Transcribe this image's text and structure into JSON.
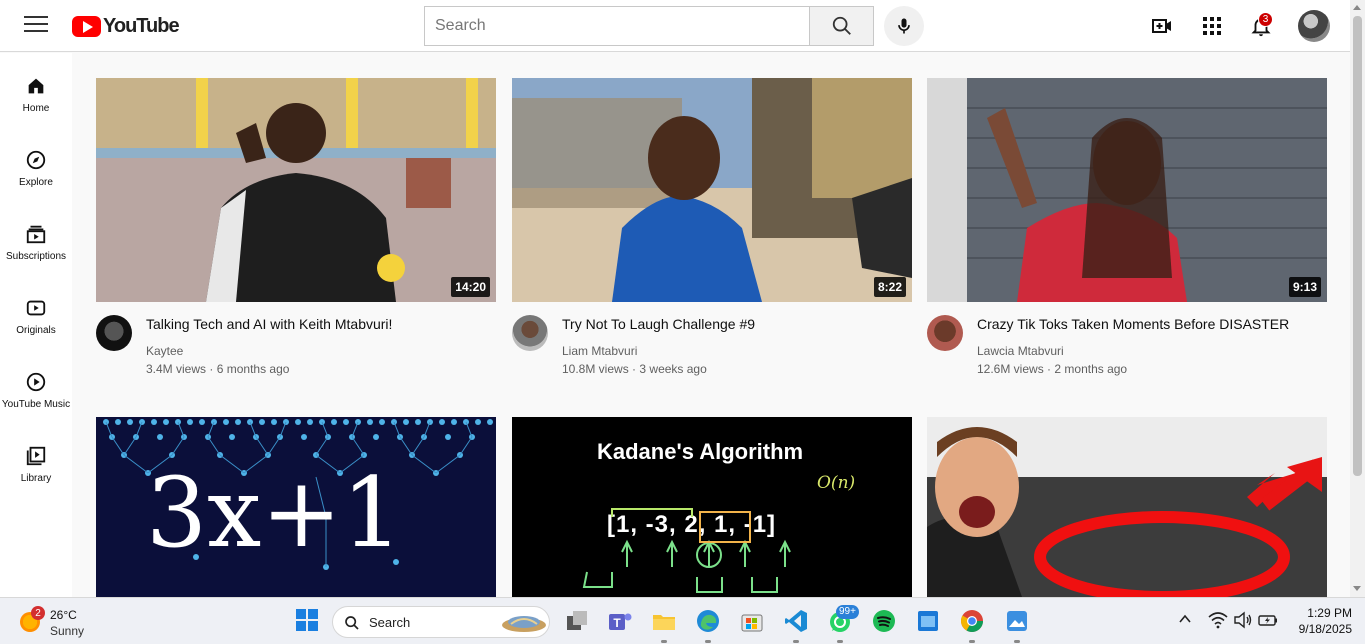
{
  "header": {
    "logo_text": "YouTube",
    "search_placeholder": "Search",
    "notification_count": "3"
  },
  "sidebar": {
    "items": [
      {
        "label": "Home",
        "icon": "home-icon"
      },
      {
        "label": "Explore",
        "icon": "compass-icon"
      },
      {
        "label": "Subscriptions",
        "icon": "subscriptions-icon"
      },
      {
        "label": "Originals",
        "icon": "originals-icon"
      },
      {
        "label": "YouTube Music",
        "icon": "music-icon"
      },
      {
        "label": "Library",
        "icon": "library-icon"
      }
    ]
  },
  "videos": [
    {
      "title": "Talking Tech and AI with Keith Mtabvuri!",
      "channel": "Kaytee",
      "views": "3.4M views",
      "age": "6 months ago",
      "duration": "14:20"
    },
    {
      "title": "Try Not To Laugh Challenge #9",
      "channel": "Liam Mtabvuri",
      "views": "10.8M views",
      "age": "3 weeks ago",
      "duration": "8:22"
    },
    {
      "title": "Crazy Tik Toks Taken Moments Before DISASTER",
      "channel": "Lawcia Mtabvuri",
      "views": "12.6M views",
      "age": "2 months ago",
      "duration": "9:13"
    },
    {
      "thumb_text": "3x+1"
    },
    {
      "thumb_text": "Kadane's Algorithm",
      "thumb_formula": "[1, -3, 2, 1, -1]",
      "thumb_note": "O(n)"
    },
    {}
  ],
  "separator": "·",
  "taskbar": {
    "weather_temp": "26°C",
    "weather_cond": "Sunny",
    "weather_badge": "2",
    "search_label": "Search",
    "whatsapp_badge": "99+",
    "time": "1:29 PM",
    "date": "9/18/2025"
  }
}
